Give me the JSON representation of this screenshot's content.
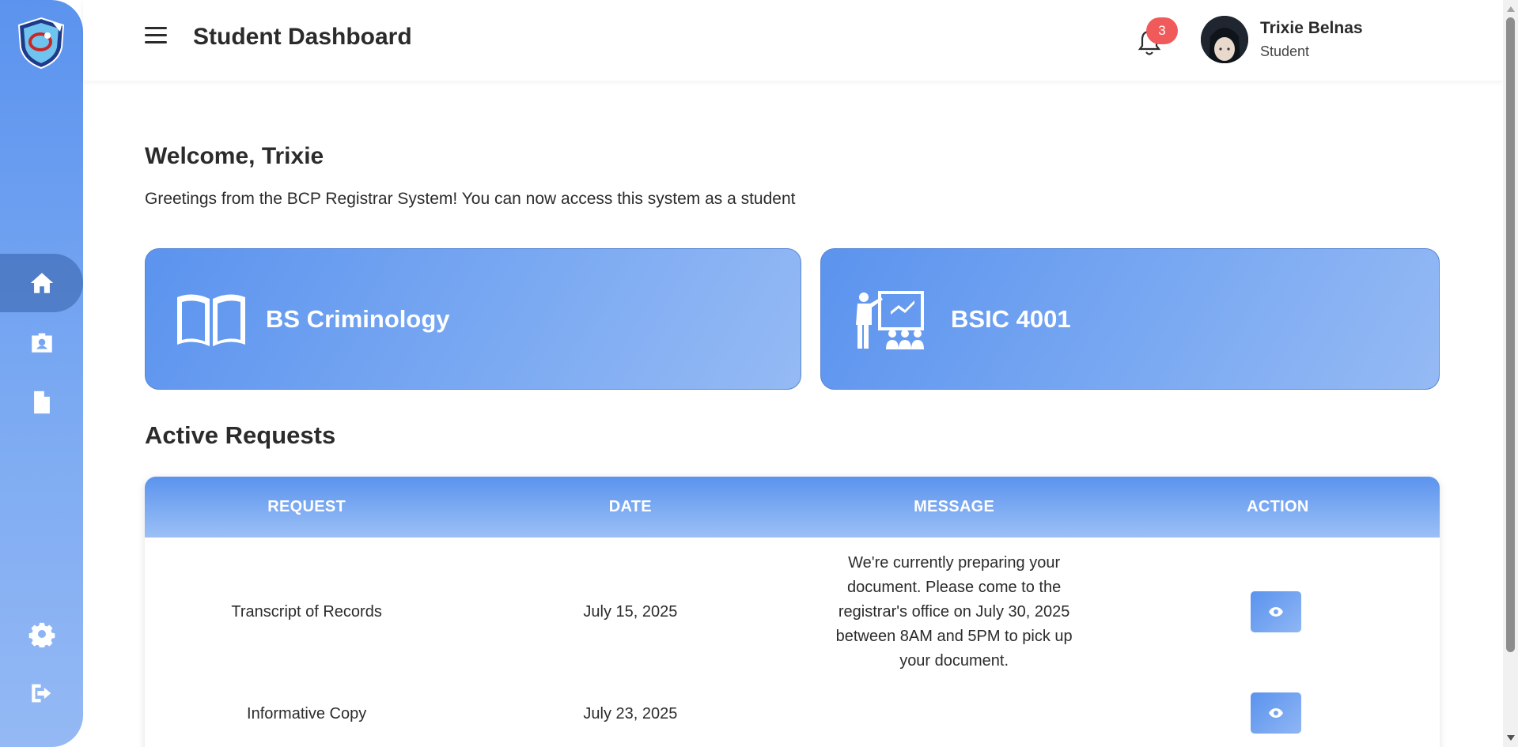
{
  "header": {
    "title": "Student Dashboard",
    "notification_count": "3",
    "user_name": "Trixie Belnas",
    "user_role": "Student"
  },
  "sidebar": {
    "items": [
      {
        "icon": "home-icon",
        "active": true
      },
      {
        "icon": "id-badge-icon",
        "active": false
      },
      {
        "icon": "document-icon",
        "active": false
      },
      {
        "icon": "gear-icon",
        "active": false
      },
      {
        "icon": "logout-icon",
        "active": false
      }
    ]
  },
  "main": {
    "welcome": "Welcome, Trixie",
    "greeting": "Greetings from the BCP Registrar System! You can now access this system as a student",
    "cards": [
      {
        "label": "BS Criminology",
        "icon": "open-book-icon"
      },
      {
        "label": "BSIC 4001",
        "icon": "classroom-icon"
      }
    ],
    "section_title": "Active Requests",
    "table": {
      "headers": [
        "REQUEST",
        "DATE",
        "MESSAGE",
        "ACTION"
      ],
      "rows": [
        {
          "request": "Transcript of Records",
          "date": "July 15, 2025",
          "message": "We're currently preparing your document. Please come to the registrar's office on July 30, 2025 between 8AM and 5PM to pick up your document."
        },
        {
          "request": "Informative Copy",
          "date": "July 23, 2025",
          "message": ""
        }
      ]
    }
  },
  "colors": {
    "accent": "#5b93ee",
    "badge": "#f05a5a"
  }
}
